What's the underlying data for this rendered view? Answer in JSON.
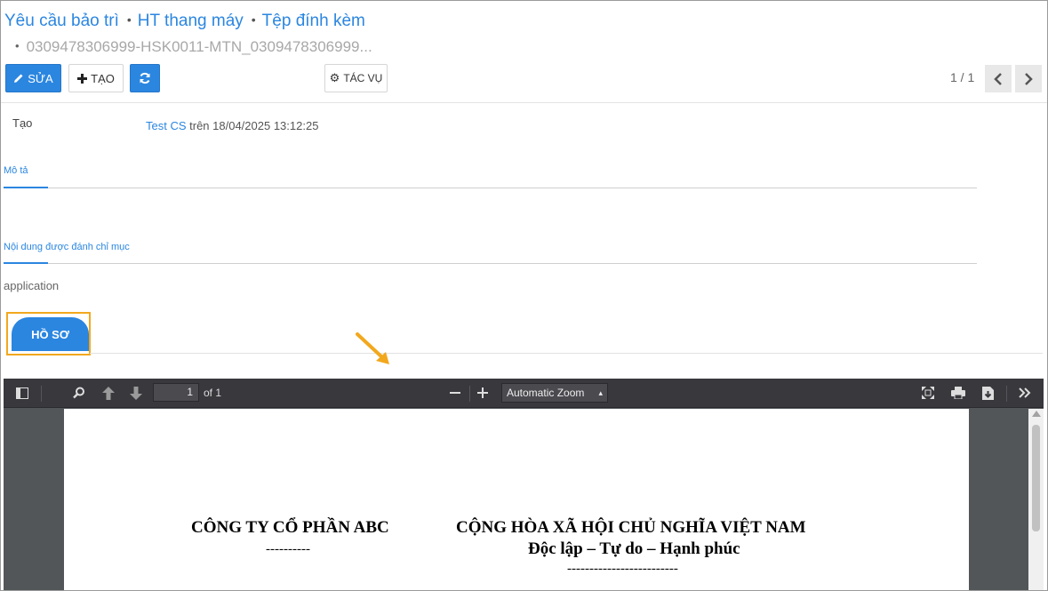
{
  "breadcrumb": {
    "items": [
      "Yêu cầu bảo trì",
      "HT thang máy",
      "Tệp đính kèm"
    ],
    "current": "0309478306999-HSK0011-MTN_0309478306999..."
  },
  "toolbar": {
    "edit_label": "SỬA",
    "create_label": "TẠO",
    "actions_label": "TÁC VỤ",
    "pager": "1 / 1"
  },
  "record": {
    "created_label": "Tạo",
    "created_by": "Test CS",
    "created_on": "trên 18/04/2025 13:12:25"
  },
  "tabs": {
    "description": "Mô tả",
    "indexed_content": "Nội dung được đánh chỉ mục"
  },
  "mimetype": "application",
  "profile_button": "HỒ SƠ",
  "pdf_viewer": {
    "page_number": "1",
    "page_total": "of 1",
    "zoom": "Automatic Zoom"
  },
  "document": {
    "company": "CÔNG TY CỔ PHẦN ABC",
    "company_rule": "----------",
    "nation": "CỘNG HÒA XÃ HỘI CHỦ NGHĨA VIỆT NAM",
    "motto": "Độc lập – Tự do – Hạnh phúc",
    "motto_rule": "-------------------------"
  },
  "colors": {
    "primary": "#2b86e0",
    "highlight": "#f2a81d"
  }
}
